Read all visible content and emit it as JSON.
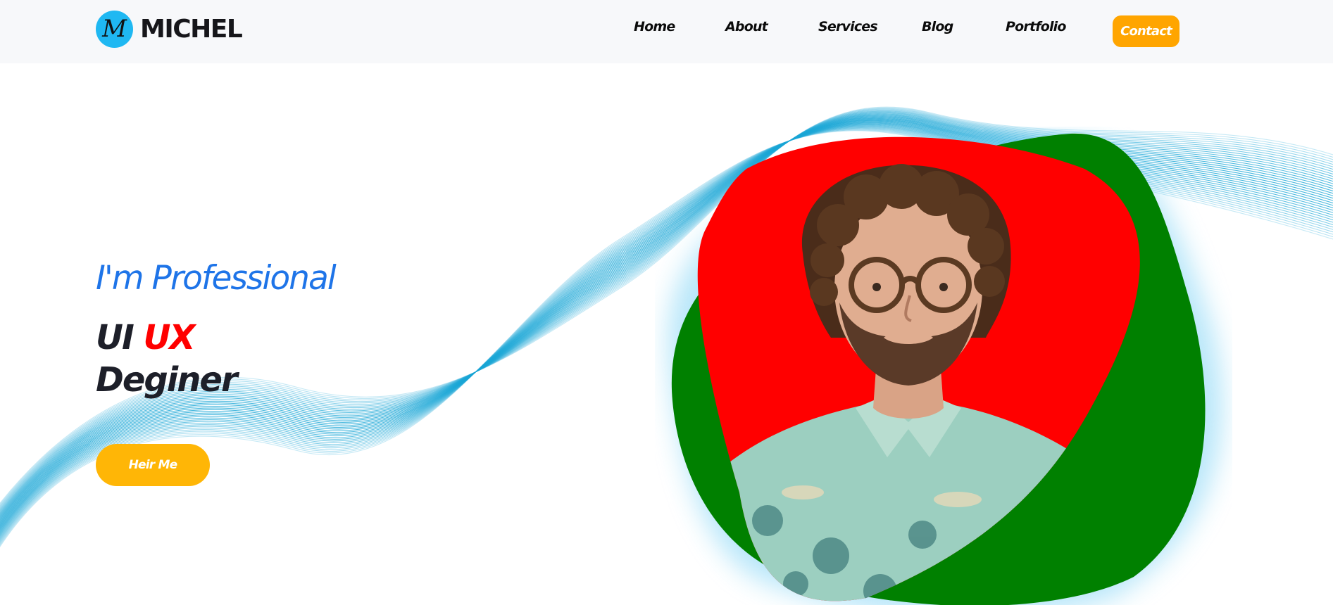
{
  "brand": {
    "logo_letter": "M",
    "name": "MICHEL"
  },
  "nav": {
    "items": [
      {
        "label": "Home"
      },
      {
        "label": "About"
      },
      {
        "label": "Services"
      },
      {
        "label": "Blog"
      },
      {
        "label": "Portfolio"
      }
    ],
    "contact_label": "Contact"
  },
  "hero": {
    "subtitle": "I'm Professional",
    "title_part1": "UI ",
    "title_accent": "UX",
    "title_line2": "Deginer",
    "cta_label": "Heir Me"
  },
  "colors": {
    "brand_badge": "#1fb8f2",
    "contact_button": "#ffa500",
    "cta_button": "#ffb606",
    "subtitle": "#1e74e8",
    "accent": "#ff0000",
    "blob_green": "#008000",
    "blob_red": "#ff0000",
    "wave": "#1aa6d6"
  },
  "icons": {
    "logo": "letter-m-badge-icon"
  }
}
